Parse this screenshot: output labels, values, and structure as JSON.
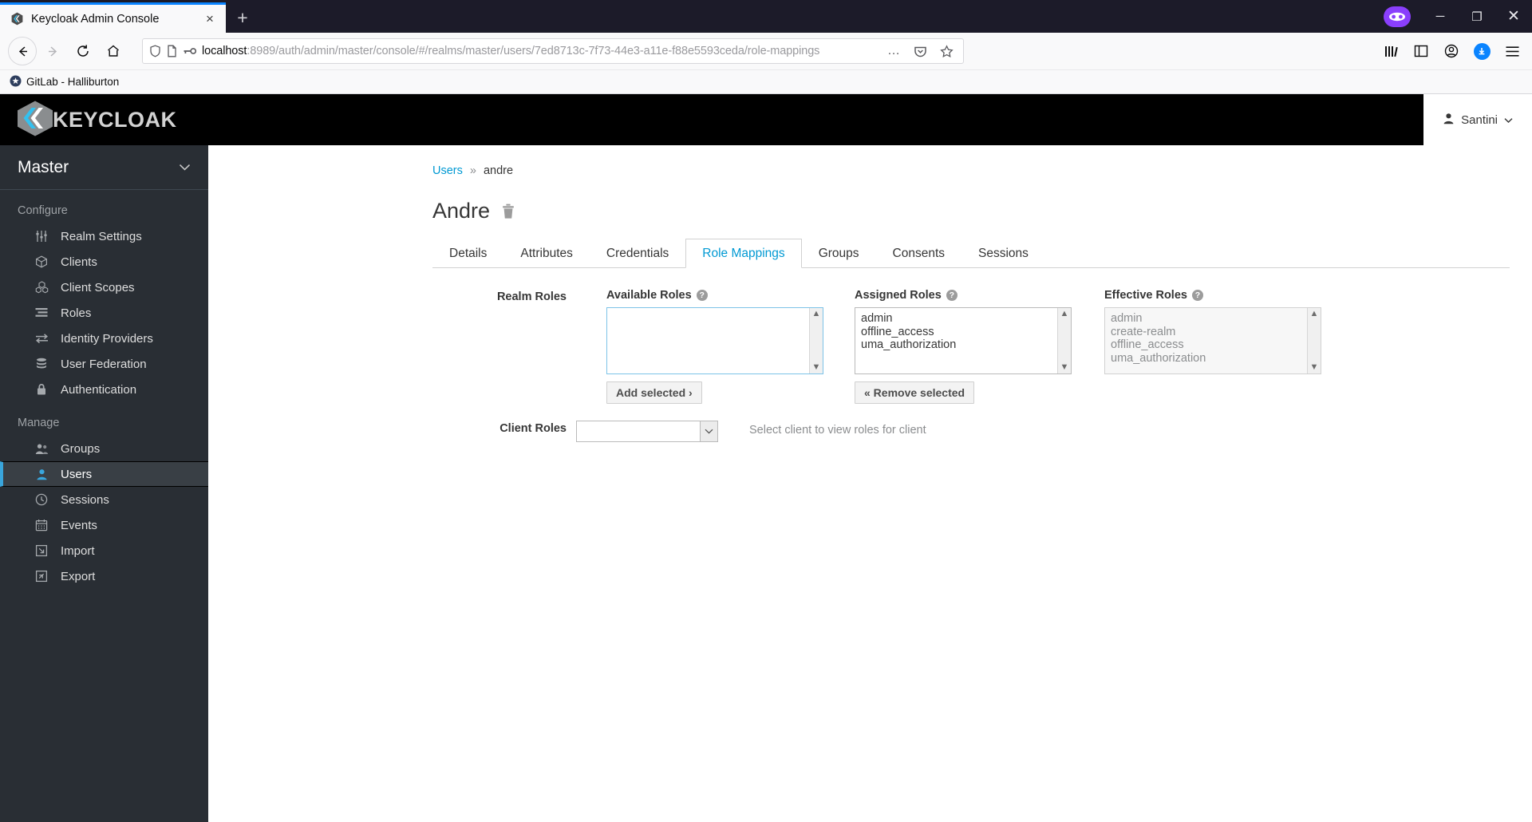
{
  "browser": {
    "tab": {
      "title": "Keycloak Admin Console",
      "favicon": "keycloak-favicon",
      "close": "×"
    },
    "new_tab": "+",
    "window_controls": {
      "minimize": "─",
      "maximize": "❐",
      "close": "✕"
    },
    "nav": {
      "back": "←",
      "forward": "→",
      "reload": "⟳",
      "home": "⌂"
    },
    "url": {
      "host": "localhost",
      "path": ":8989/auth/admin/master/console/#/realms/master/users/7ed8713c-7f73-44e3-a11e-f88e5593ceda/role-mappings",
      "full": "localhost:8989/auth/admin/master/console/#/realms/master/users/7ed8713c-7f73-44e3-a11e-f88e5593ceda/role-mappings",
      "page_actions": "…"
    },
    "bookmark": {
      "label": "GitLab - Halliburton"
    }
  },
  "header": {
    "brand": "KEYCLOAK",
    "user_menu": {
      "label": "Santini",
      "caret": "⌄"
    }
  },
  "sidebar": {
    "realm": {
      "name": "Master",
      "caret": "⌄"
    },
    "sections": [
      {
        "title": "Configure",
        "items": [
          {
            "label": "Realm Settings",
            "icon": "sliders-icon",
            "active": false
          },
          {
            "label": "Clients",
            "icon": "cube-icon",
            "active": false
          },
          {
            "label": "Client Scopes",
            "icon": "cubes-icon",
            "active": false
          },
          {
            "label": "Roles",
            "icon": "list-icon",
            "active": false
          },
          {
            "label": "Identity Providers",
            "icon": "exchange-icon",
            "active": false
          },
          {
            "label": "User Federation",
            "icon": "database-icon",
            "active": false
          },
          {
            "label": "Authentication",
            "icon": "lock-icon",
            "active": false
          }
        ]
      },
      {
        "title": "Manage",
        "items": [
          {
            "label": "Groups",
            "icon": "users-icon",
            "active": false
          },
          {
            "label": "Users",
            "icon": "user-icon",
            "active": true
          },
          {
            "label": "Sessions",
            "icon": "clock-icon",
            "active": false
          },
          {
            "label": "Events",
            "icon": "calendar-icon",
            "active": false
          },
          {
            "label": "Import",
            "icon": "import-icon",
            "active": false
          },
          {
            "label": "Export",
            "icon": "export-icon",
            "active": false
          }
        ]
      }
    ]
  },
  "main": {
    "breadcrumb": {
      "root": "Users",
      "separator": "»",
      "current": "andre"
    },
    "page_title": "Andre",
    "delete_icon": "trash-icon",
    "tabs": [
      {
        "label": "Details",
        "active": false
      },
      {
        "label": "Attributes",
        "active": false
      },
      {
        "label": "Credentials",
        "active": false
      },
      {
        "label": "Role Mappings",
        "active": true
      },
      {
        "label": "Groups",
        "active": false
      },
      {
        "label": "Consents",
        "active": false
      },
      {
        "label": "Sessions",
        "active": false
      }
    ],
    "role_mappings": {
      "realm_roles_label": "Realm Roles",
      "available": {
        "label": "Available Roles",
        "help": "?",
        "items": [],
        "button": "Add selected ›"
      },
      "assigned": {
        "label": "Assigned Roles",
        "help": "?",
        "items": [
          "admin",
          "offline_access",
          "uma_authorization"
        ],
        "button": "« Remove selected"
      },
      "effective": {
        "label": "Effective Roles",
        "help": "?",
        "items": [
          "admin",
          "create-realm",
          "offline_access",
          "uma_authorization"
        ],
        "disabled": true
      },
      "client_roles_label": "Client Roles",
      "client_select_value": "",
      "client_hint": "Select client to view roles for client"
    }
  },
  "colors": {
    "accent": "#0099d3",
    "sidebar_bg": "#292e34",
    "sidebar_active": "#393f45",
    "active_border": "#39a5dc",
    "header_bg": "#000000",
    "tab_bar_blue": "#0a84ff"
  }
}
